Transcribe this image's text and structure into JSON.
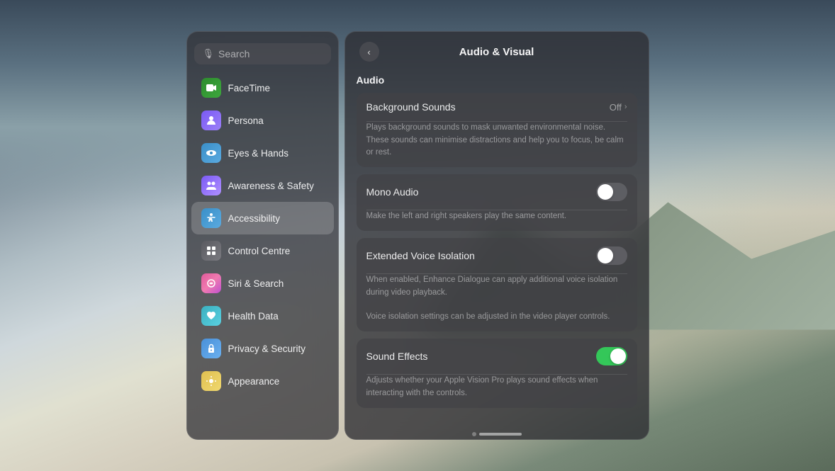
{
  "background": {
    "description": "Desert sand dunes with mountain and cloudy sky"
  },
  "sidebar": {
    "search_placeholder": "Search",
    "items": [
      {
        "id": "facetime",
        "label": "FaceTime",
        "icon_class": "icon-facetime",
        "icon_char": "📹"
      },
      {
        "id": "persona",
        "label": "Persona",
        "icon_class": "icon-persona",
        "icon_char": "👤"
      },
      {
        "id": "eyes-hands",
        "label": "Eyes & Hands",
        "icon_class": "icon-eyes",
        "icon_char": "👁"
      },
      {
        "id": "awareness-safety",
        "label": "Awareness & Safety",
        "icon_class": "icon-awareness",
        "icon_char": "👥"
      },
      {
        "id": "accessibility",
        "label": "Accessibility",
        "icon_class": "icon-accessibility",
        "icon_char": "♿",
        "active": true
      },
      {
        "id": "control-centre",
        "label": "Control Centre",
        "icon_class": "icon-control",
        "icon_char": "⊞"
      },
      {
        "id": "siri-search",
        "label": "Siri & Search",
        "icon_class": "icon-siri",
        "icon_char": "🎙"
      },
      {
        "id": "health-data",
        "label": "Health Data",
        "icon_class": "icon-health",
        "icon_char": "❤"
      },
      {
        "id": "privacy-security",
        "label": "Privacy & Security",
        "icon_class": "icon-privacy",
        "icon_char": "🔒"
      },
      {
        "id": "appearance",
        "label": "Appearance",
        "icon_class": "icon-appearance",
        "icon_char": "☀"
      }
    ]
  },
  "panel": {
    "title": "Audio & Visual",
    "back_button_label": "‹",
    "sections": [
      {
        "header": "Audio",
        "items": [
          {
            "id": "background-sounds",
            "label": "Background Sounds",
            "type": "navigation",
            "value": "Off",
            "description": "Plays background sounds to mask unwanted environmental noise. These sounds can minimise distractions and help you to focus, be calm or rest."
          },
          {
            "id": "mono-audio",
            "label": "Mono Audio",
            "type": "toggle",
            "enabled": false,
            "description": "Make the left and right speakers play the same content."
          },
          {
            "id": "extended-voice-isolation",
            "label": "Extended Voice Isolation",
            "type": "toggle",
            "enabled": false,
            "description1": "When enabled, Enhance Dialogue can apply additional voice isolation during video playback.",
            "description2": "Voice isolation settings can be adjusted in the video player controls."
          },
          {
            "id": "sound-effects",
            "label": "Sound Effects",
            "type": "toggle",
            "enabled": true,
            "description": "Adjusts whether your Apple Vision Pro plays sound effects when interacting with the controls."
          }
        ]
      }
    ]
  }
}
